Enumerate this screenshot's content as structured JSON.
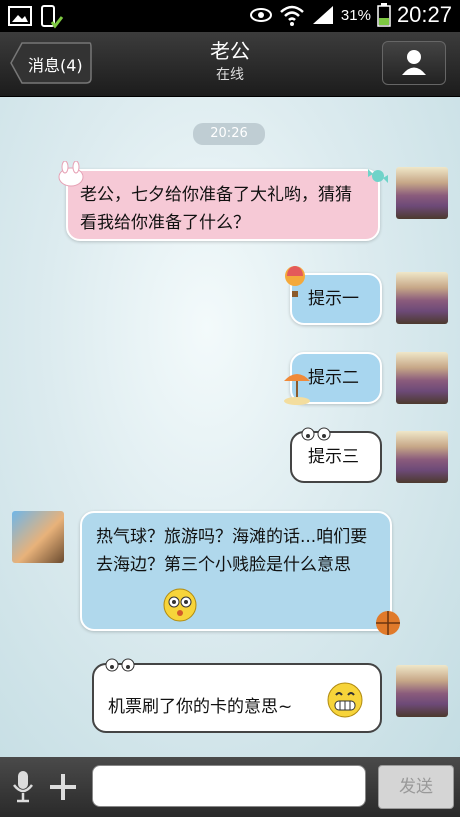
{
  "statusbar": {
    "battery_pct": "31%",
    "time": "20:27"
  },
  "header": {
    "back_label": "消息(4)",
    "title": "老公",
    "subtitle": "在线"
  },
  "chat": {
    "timestamp": "20:26",
    "messages": [
      {
        "from": "me",
        "text": "老公，七夕给你准备了大礼哟，猜猜看我给你准备了什么？"
      },
      {
        "from": "me",
        "text": "提示一"
      },
      {
        "from": "me",
        "text": "提示二"
      },
      {
        "from": "me",
        "text": "提示三"
      },
      {
        "from": "other",
        "text": "热气球？旅游吗？海滩的话...咱们要去海边？第三个小贱脸是什么意思"
      },
      {
        "from": "other",
        "text": "机票刷了你的卡的意思~"
      }
    ]
  },
  "inputbar": {
    "value": "",
    "placeholder": "",
    "send_label": "发送"
  },
  "colors": {
    "pink_bubble": "#f6c9d6",
    "blue_bubble": "#a8d6ef",
    "header": "#2c2c2c"
  }
}
